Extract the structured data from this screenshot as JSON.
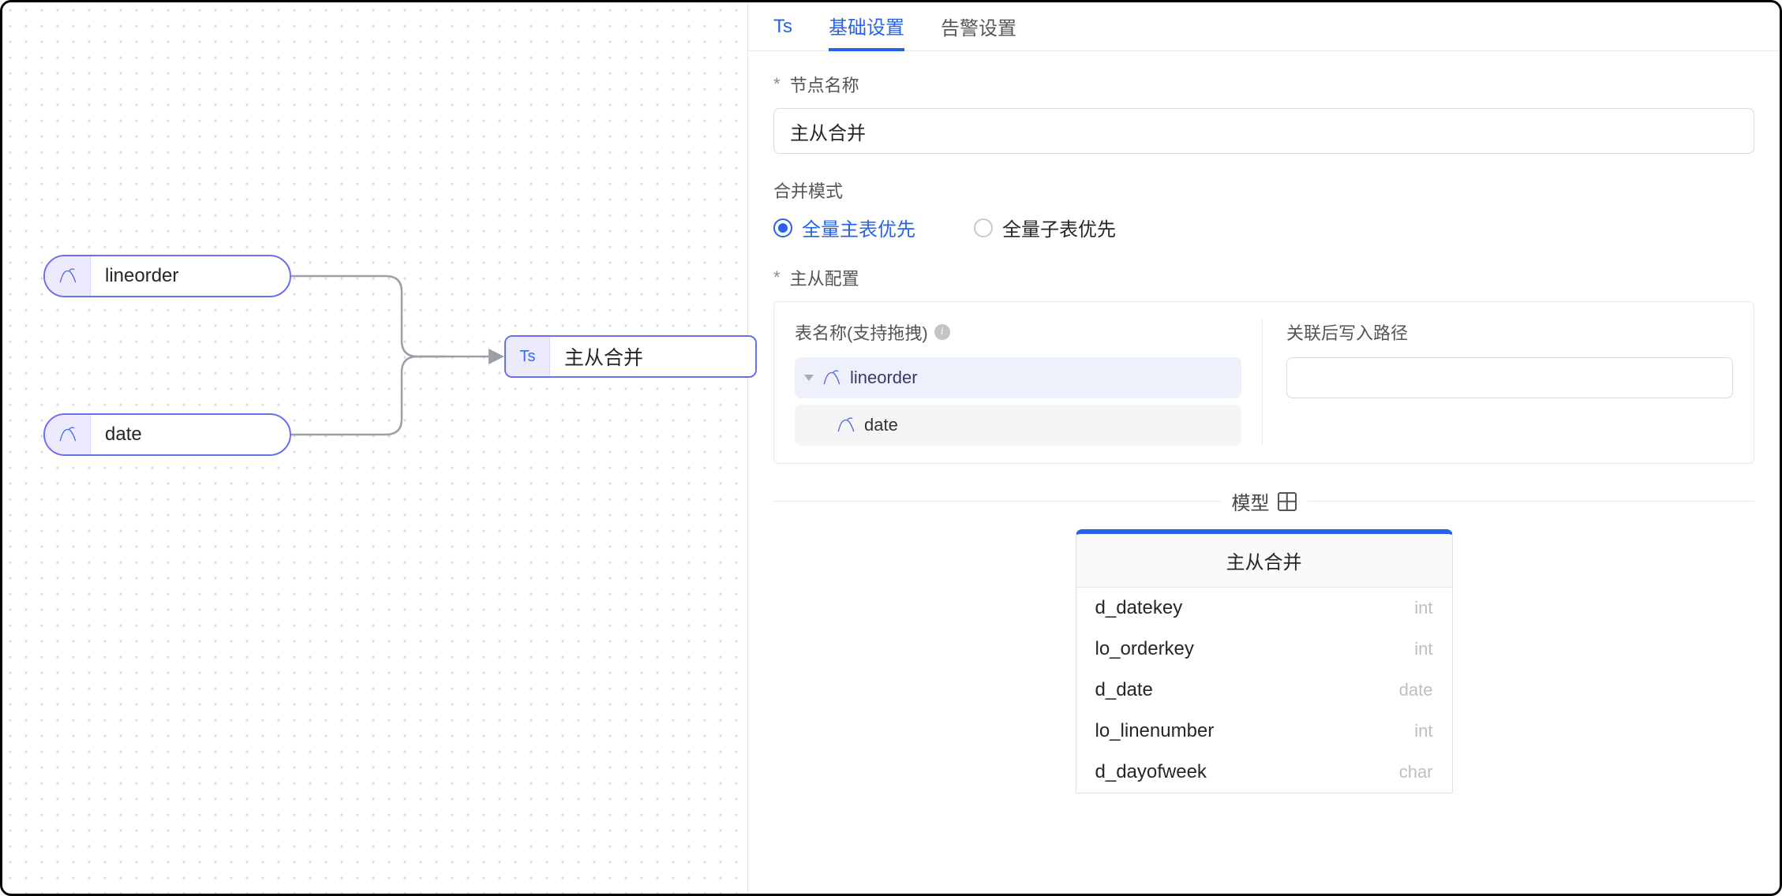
{
  "canvas": {
    "node1": {
      "label": "lineorder"
    },
    "node2": {
      "label": "date"
    },
    "merge_node": {
      "icon_label": "Ts",
      "label": "主从合并"
    }
  },
  "tabs": {
    "ts": "Ts",
    "basic": "基础设置",
    "alert": "告警设置"
  },
  "form": {
    "node_name_label": "节点名称",
    "node_name_value": "主从合并",
    "merge_mode_label": "合并模式",
    "merge_mode_options": {
      "main_first": "全量主表优先",
      "sub_first": "全量子表优先"
    },
    "master_slave_label": "主从配置",
    "table_name_label": "表名称(支持拖拽)",
    "write_path_label": "关联后写入路径",
    "write_path_value": "",
    "tree": {
      "root": "lineorder",
      "child": "date"
    }
  },
  "model": {
    "section_label": "模型",
    "card_title": "主从合并",
    "fields": [
      {
        "name": "d_datekey",
        "type": "int"
      },
      {
        "name": "lo_orderkey",
        "type": "int"
      },
      {
        "name": "d_date",
        "type": "date"
      },
      {
        "name": "lo_linenumber",
        "type": "int"
      },
      {
        "name": "d_dayofweek",
        "type": "char"
      }
    ]
  }
}
